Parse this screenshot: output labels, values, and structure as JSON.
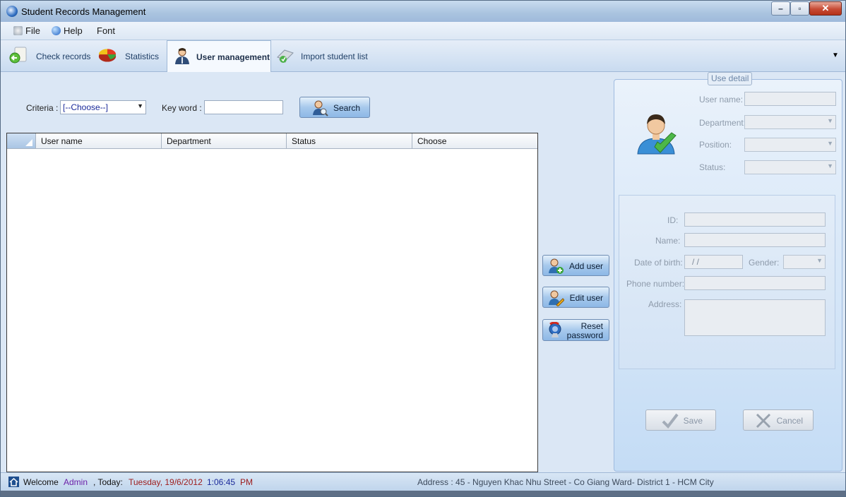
{
  "window": {
    "title": "Student Records Management",
    "minimize": "–",
    "maximize": "▫",
    "close": "✕"
  },
  "menu": {
    "file": "File",
    "help": "Help",
    "font": "Font"
  },
  "tabs": [
    {
      "label": "Check records"
    },
    {
      "label": "Statistics"
    },
    {
      "label": "User management"
    },
    {
      "label": "Import student list"
    }
  ],
  "tabs_dropdown": "▼",
  "search": {
    "criteria_label": "Criteria :",
    "criteria_value": "[--Choose--]",
    "keyword_label": "Key word :",
    "keyword_value": "",
    "search_button": "Search"
  },
  "grid": {
    "columns": [
      "User name",
      "Department",
      "Status",
      "Choose"
    ],
    "rows": []
  },
  "actions": {
    "add_user": "Add user",
    "edit_user": "Edit user",
    "reset_password_line1": "Reset",
    "reset_password_line2": "password"
  },
  "detail": {
    "title": "Use detail",
    "user_name_label": "User name:",
    "department_label": "Department:",
    "position_label": "Position:",
    "status_label": "Status:",
    "id_label": "ID:",
    "name_label": "Name:",
    "dob_label": "Date of birth:",
    "dob_value": "/ /",
    "gender_label": "Gender:",
    "phone_label": "Phone number:",
    "address_label": "Address:",
    "save_button": "Save",
    "cancel_button": "Cancel"
  },
  "status": {
    "welcome": "Welcome",
    "user": "Admin",
    "today_label": ", Today:",
    "date": "Tuesday, 19/6/2012",
    "time": "1:06:45",
    "ampm": "PM",
    "address": "Address : 45 - Nguyen Khac Nhu Street - Co Giang Ward- District 1 - HCM City"
  },
  "colors": {
    "accent": "#8db8e6",
    "user_text": "#6b1fa8",
    "date_text": "#9c1a1a",
    "time_text": "#1a2a9a"
  }
}
